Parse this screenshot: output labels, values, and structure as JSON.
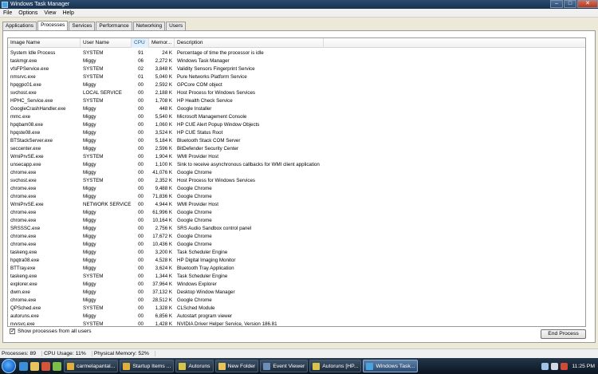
{
  "window": {
    "title": "Windows Task Manager",
    "minimize": "–",
    "maximize": "□",
    "close": "✕"
  },
  "menu": [
    "File",
    "Options",
    "View",
    "Help"
  ],
  "tabs": [
    "Applications",
    "Processes",
    "Services",
    "Performance",
    "Networking",
    "Users"
  ],
  "active_tab": "Processes",
  "columns": {
    "name": "Image Name",
    "user": "User Name",
    "cpu": "CPU",
    "mem": "Memor...",
    "desc": "Description"
  },
  "sorted_column": "cpu",
  "processes": [
    [
      "System Idle Process",
      "SYSTEM",
      "91",
      "24 K",
      "Percentage of time the processor is idle"
    ],
    [
      "taskmgr.exe",
      "Miggy",
      "06",
      "2,272 K",
      "Windows Task Manager"
    ],
    [
      "vfsFPService.exe",
      "SYSTEM",
      "02",
      "3,848 K",
      "Validity Sensors Fingerprint Service"
    ],
    [
      "nmsrvc.exe",
      "SYSTEM",
      "01",
      "5,040 K",
      "Pure Networks Platform Service"
    ],
    [
      "hpqgpc01.exe",
      "Miggy",
      "00",
      "2,592 K",
      "GPCore COM object"
    ],
    [
      "svchost.exe",
      "LOCAL SERVICE",
      "00",
      "2,188 K",
      "Host Process for Windows Services"
    ],
    [
      "HPHC_Service.exe",
      "SYSTEM",
      "00",
      "1,708 K",
      "HP Health Check Service"
    ],
    [
      "GoogleCrashHandler.exe",
      "Miggy",
      "00",
      "448 K",
      "Google Installer"
    ],
    [
      "mmc.exe",
      "Miggy",
      "00",
      "5,540 K",
      "Microsoft Management Console"
    ],
    [
      "hpqbam08.exe",
      "Miggy",
      "00",
      "1,060 K",
      "HP CUE Alert Popup Window Objects"
    ],
    [
      "hpqste08.exe",
      "Miggy",
      "00",
      "3,524 K",
      "HP CUE Status Root"
    ],
    [
      "BTStackServer.exe",
      "Miggy",
      "00",
      "5,184 K",
      "Bluetooth Stack COM Server"
    ],
    [
      "seccenter.exe",
      "Miggy",
      "00",
      "2,596 K",
      "BitDefender Security Center"
    ],
    [
      "WmiPrvSE.exe",
      "SYSTEM",
      "00",
      "1,904 K",
      "WMI Provider Host"
    ],
    [
      "unsecapp.exe",
      "Miggy",
      "00",
      "1,100 K",
      "Sink to receive asynchronous callbacks for WMI client application"
    ],
    [
      "chrome.exe",
      "Miggy",
      "00",
      "41,076 K",
      "Google Chrome"
    ],
    [
      "svchost.exe",
      "SYSTEM",
      "00",
      "2,352 K",
      "Host Process for Windows Services"
    ],
    [
      "chrome.exe",
      "Miggy",
      "00",
      "9,488 K",
      "Google Chrome"
    ],
    [
      "chrome.exe",
      "Miggy",
      "00",
      "71,836 K",
      "Google Chrome"
    ],
    [
      "WmiPrvSE.exe",
      "NETWORK SERVICE",
      "00",
      "4,944 K",
      "WMI Provider Host"
    ],
    [
      "chrome.exe",
      "Miggy",
      "00",
      "61,996 K",
      "Google Chrome"
    ],
    [
      "chrome.exe",
      "Miggy",
      "00",
      "10,164 K",
      "Google Chrome"
    ],
    [
      "SRSSSC.exe",
      "Miggy",
      "00",
      "2,756 K",
      "SRS Audio Sandbox control panel"
    ],
    [
      "chrome.exe",
      "Miggy",
      "00",
      "17,672 K",
      "Google Chrome"
    ],
    [
      "chrome.exe",
      "Miggy",
      "00",
      "10,436 K",
      "Google Chrome"
    ],
    [
      "taskeng.exe",
      "Miggy",
      "00",
      "3,200 K",
      "Task Scheduler Engine"
    ],
    [
      "hpqtra08.exe",
      "Miggy",
      "00",
      "4,528 K",
      "HP Digital Imaging Monitor"
    ],
    [
      "BTTray.exe",
      "Miggy",
      "00",
      "3,624 K",
      "Bluetooth Tray Application"
    ],
    [
      "taskeng.exe",
      "SYSTEM",
      "00",
      "1,344 K",
      "Task Scheduler Engine"
    ],
    [
      "explorer.exe",
      "Miggy",
      "00",
      "37,964 K",
      "Windows Explorer"
    ],
    [
      "dwm.exe",
      "Miggy",
      "00",
      "37,132 K",
      "Desktop Window Manager"
    ],
    [
      "chrome.exe",
      "Miggy",
      "00",
      "28,512 K",
      "Google Chrome"
    ],
    [
      "QPSched.exe",
      "SYSTEM",
      "00",
      "1,328 K",
      "CLSched Module"
    ],
    [
      "autoruns.exe",
      "Miggy",
      "00",
      "6,856 K",
      "Autostart program viewer"
    ],
    [
      "nvvsvc.exe",
      "SYSTEM",
      "00",
      "1,428 K",
      "NVIDIA Driver Helper Service, Version 186.81"
    ]
  ],
  "show_all_label": "Show processes from all users",
  "show_all_checked": "✓",
  "end_process_label": "End Process",
  "status": {
    "processes": "Processes: 89",
    "cpu": "CPU Usage: 11%",
    "memory": "Physical Memory: 52%"
  },
  "taskbar": {
    "buttons": [
      {
        "label": "carmelapantal...",
        "icon": "chrome-icon",
        "color": "#e0b03a"
      },
      {
        "label": "Startup Items ...",
        "icon": "chrome-icon",
        "color": "#e0b03a"
      },
      {
        "label": "Autoruns",
        "icon": "autoruns-icon",
        "color": "#d9c44a"
      },
      {
        "label": "New Folder",
        "icon": "folder-icon",
        "color": "#e8c25a"
      },
      {
        "label": "Event Viewer",
        "icon": "event-viewer-icon",
        "color": "#6b8fb8"
      },
      {
        "label": "Autoruns [HP...",
        "icon": "autoruns-icon",
        "color": "#d9c44a"
      },
      {
        "label": "Windows Task...",
        "icon": "task-manager-icon",
        "color": "#4aa3df",
        "active": true
      }
    ],
    "clock": "11:25 PM"
  }
}
